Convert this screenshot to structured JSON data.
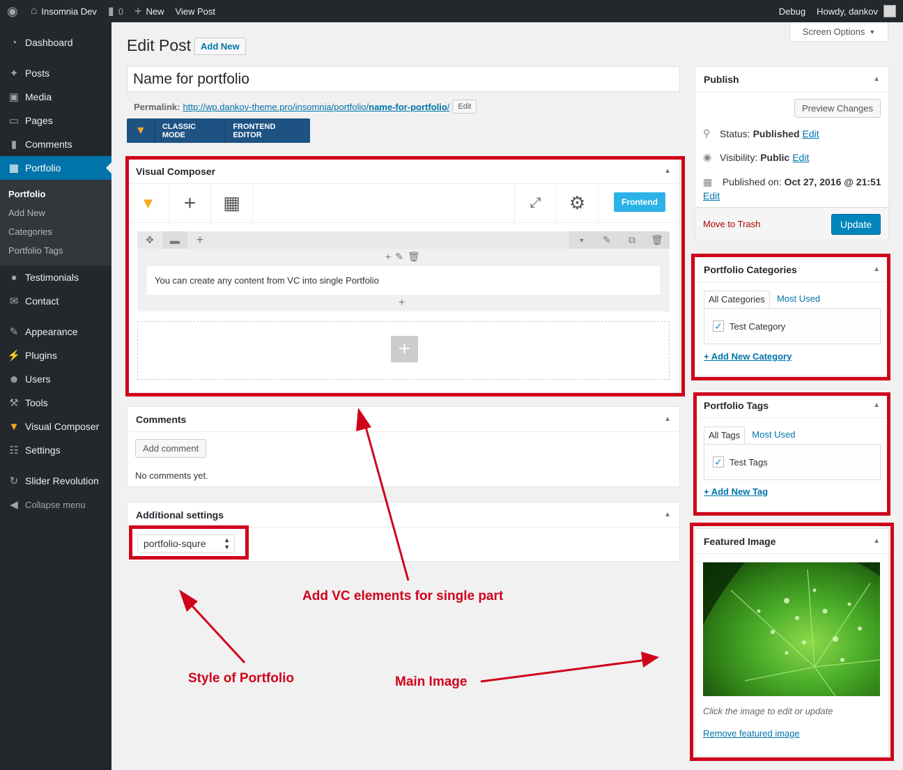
{
  "admin_bar": {
    "site_name": "Insomnia Dev",
    "comments_count": "0",
    "new_label": "New",
    "view_post": "View Post",
    "debug": "Debug",
    "howdy": "Howdy, dankov"
  },
  "sidebar": {
    "items": [
      {
        "label": "Dashboard",
        "icon": "dashboard-icon"
      },
      {
        "label": "Posts",
        "icon": "pin-icon"
      },
      {
        "label": "Media",
        "icon": "media-icon"
      },
      {
        "label": "Pages",
        "icon": "page-icon"
      },
      {
        "label": "Comments",
        "icon": "comment-icon"
      },
      {
        "label": "Portfolio",
        "icon": "folder-icon"
      },
      {
        "label": "Testimonials",
        "icon": "speech-bubble-icon"
      },
      {
        "label": "Contact",
        "icon": "mail-icon"
      },
      {
        "label": "Appearance",
        "icon": "brush-icon"
      },
      {
        "label": "Plugins",
        "icon": "plug-icon"
      },
      {
        "label": "Users",
        "icon": "user-icon"
      },
      {
        "label": "Tools",
        "icon": "wrench-icon"
      },
      {
        "label": "Visual Composer",
        "icon": "vc-logo-icon"
      },
      {
        "label": "Settings",
        "icon": "settings-icon"
      },
      {
        "label": "Slider Revolution",
        "icon": "refresh-icon"
      }
    ],
    "submenu": [
      "Portfolio",
      "Add New",
      "Categories",
      "Portfolio Tags"
    ],
    "collapse": "Collapse menu"
  },
  "header": {
    "title": "Edit Post",
    "add_new": "Add New",
    "screen_options": "Screen Options"
  },
  "post": {
    "title": "Name for portfolio",
    "permalink_label": "Permalink:",
    "permalink_url": "http://wp.dankov-theme.pro/insomnia/portfolio/",
    "permalink_slug": "name-for-portfolio",
    "permalink_end": "/",
    "edit": "Edit"
  },
  "vc_switch": {
    "classic": "CLASSIC MODE",
    "frontend": "FRONTEND EDITOR"
  },
  "visual_composer": {
    "title": "Visual Composer",
    "frontend_button": "Frontend",
    "text_element": "You can create any content from VC into single Portfolio"
  },
  "comments_box": {
    "title": "Comments",
    "add_comment": "Add comment",
    "no_comments": "No comments yet."
  },
  "additional_settings": {
    "title": "Additional settings",
    "selected": "portfolio-squre"
  },
  "publish": {
    "title": "Publish",
    "preview": "Preview Changes",
    "status_label": "Status:",
    "status_value": "Published",
    "visibility_label": "Visibility:",
    "visibility_value": "Public",
    "published_label": "Published on:",
    "published_value": "Oct 27, 2016 @ 21:51",
    "edit": "Edit",
    "trash": "Move to Trash",
    "update": "Update"
  },
  "portfolio_categories": {
    "title": "Portfolio Categories",
    "tab_all": "All Categories",
    "tab_most": "Most Used",
    "item": "Test Category",
    "add_new": "+ Add New Category"
  },
  "portfolio_tags": {
    "title": "Portfolio Tags",
    "tab_all": "All Tags",
    "tab_most": "Most Used",
    "item": "Test Tags",
    "add_new": "+ Add New Tag"
  },
  "featured_image": {
    "title": "Featured Image",
    "hint": "Click the image to edit or update",
    "remove": "Remove featured image"
  },
  "annotations": {
    "vc": "Add VC elements for single part",
    "style": "Style of Portfolio",
    "main_image": "Main Image"
  },
  "colors": {
    "accent": "#0073aa",
    "annotation_red": "#d0021b",
    "vc_frontend": "#2bb3e9"
  }
}
